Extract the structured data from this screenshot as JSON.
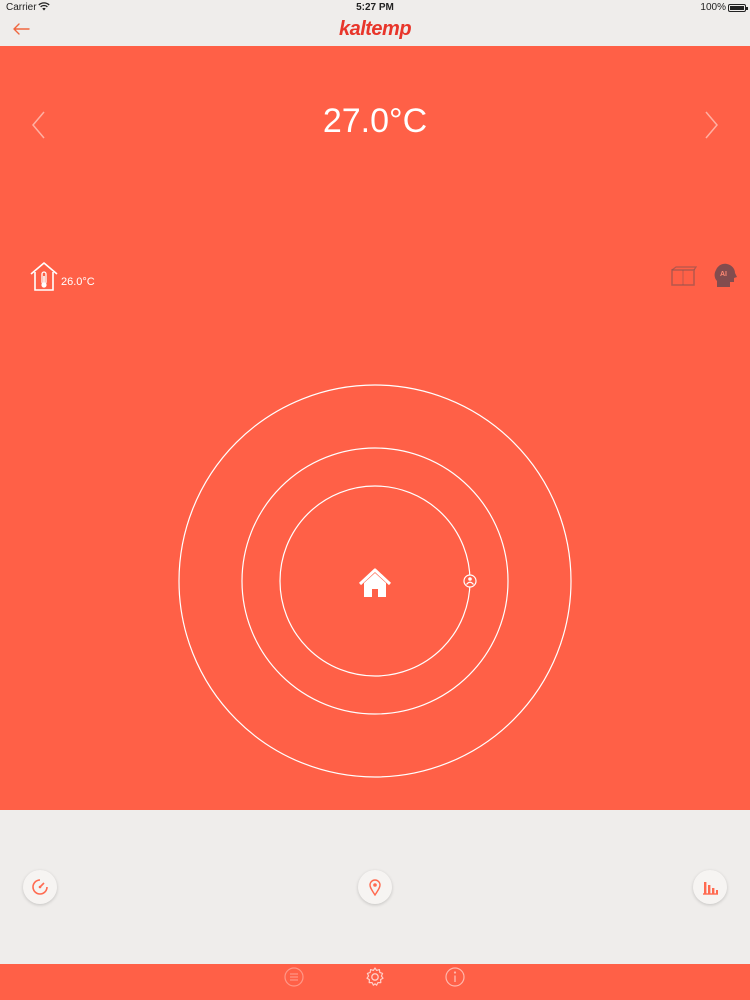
{
  "status_bar": {
    "carrier": "Carrier",
    "time": "5:27 PM",
    "battery": "100%"
  },
  "nav": {
    "back_icon": "arrow-left-icon",
    "brand": "kaltemp"
  },
  "main": {
    "set_temperature": "27.0°C",
    "indoor_temperature": "26.0°C",
    "prev_icon": "chevron-left-icon",
    "next_icon": "chevron-right-icon",
    "indoor_icon": "house-thermometer-icon",
    "window_icon": "window-icon",
    "ai_icon": "ai-head-icon",
    "radar_center_icon": "home-icon",
    "radar_marker_icon": "user-marker-icon"
  },
  "controls": {
    "timer_icon": "timer-icon",
    "location_icon": "location-pin-icon",
    "stats_icon": "bar-chart-icon"
  },
  "tabs": {
    "list_icon": "list-icon",
    "settings_icon": "gear-icon",
    "info_icon": "info-icon"
  },
  "colors": {
    "accent": "#ff6047",
    "brand": "#e8352a",
    "panel": "#efedeb"
  }
}
